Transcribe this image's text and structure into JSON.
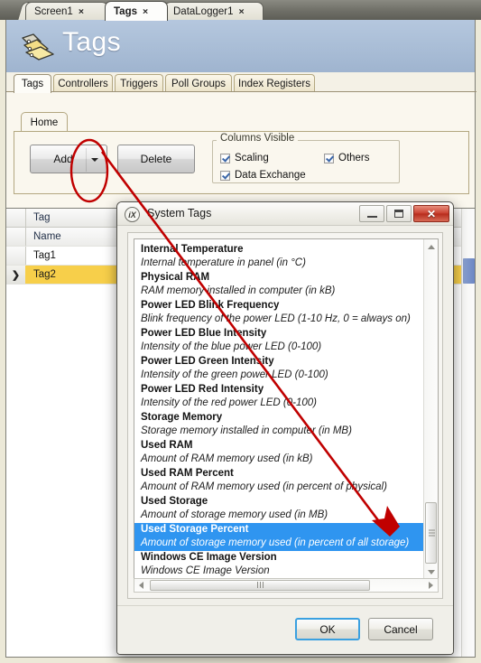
{
  "window": {
    "doc_tabs": [
      {
        "label": "Screen1",
        "close": "×",
        "active": false
      },
      {
        "label": "Tags",
        "close": "×",
        "active": true
      },
      {
        "label": "DataLogger1",
        "close": "×",
        "active": false
      }
    ]
  },
  "banner": {
    "title": "Tags",
    "icon": "tags-icon"
  },
  "inner_tabs": [
    {
      "label": "Tags",
      "active": true
    },
    {
      "label": "Controllers",
      "active": false
    },
    {
      "label": "Triggers",
      "active": false
    },
    {
      "label": "Poll Groups",
      "active": false
    },
    {
      "label": "Index Registers",
      "active": false
    }
  ],
  "ribbon": {
    "tab_label": "Home",
    "add_button": "Add",
    "delete_button": "Delete",
    "group_title": "Columns Visible",
    "checkboxes": [
      {
        "label": "Scaling",
        "checked": true
      },
      {
        "label": "Data Exchange",
        "checked": true
      },
      {
        "label": "Others",
        "checked": true
      }
    ]
  },
  "grid": {
    "group_header": "Tag",
    "column_header": "Name",
    "rows": [
      {
        "marker": "",
        "name": "Tag1",
        "selected": false
      },
      {
        "marker": "❯",
        "name": "Tag2",
        "selected": true
      }
    ]
  },
  "dialog": {
    "title": "System Tags",
    "icon": "ix-logo-icon",
    "window_buttons": {
      "minimize": "minimize-icon",
      "maximize": "maximize-icon",
      "close": "✕"
    },
    "items": [
      {
        "name": "Internal Temperature",
        "desc": "Internal temperature in panel (in °C)",
        "selected": false
      },
      {
        "name": "Physical RAM",
        "desc": "RAM memory installed in computer (in kB)",
        "selected": false
      },
      {
        "name": "Power LED Blink Frequency",
        "desc": "Blink frequency of the power LED (1-10 Hz, 0 = always on)",
        "selected": false
      },
      {
        "name": "Power LED Blue Intensity",
        "desc": "Intensity of the blue power LED (0-100)",
        "selected": false
      },
      {
        "name": "Power LED Green Intensity",
        "desc": "Intensity of the green power LED (0-100)",
        "selected": false
      },
      {
        "name": "Power LED Red Intensity",
        "desc": "Intensity of the red power LED (0-100)",
        "selected": false
      },
      {
        "name": "Storage Memory",
        "desc": "Storage memory installed in computer (in MB)",
        "selected": false
      },
      {
        "name": "Used RAM",
        "desc": "Amount of RAM memory used (in kB)",
        "selected": false
      },
      {
        "name": "Used RAM Percent",
        "desc": "Amount of RAM memory used (in percent of physical)",
        "selected": false
      },
      {
        "name": "Used Storage",
        "desc": "Amount of storage memory used (in MB)",
        "selected": false
      },
      {
        "name": "Used Storage Percent",
        "desc": "Amount of storage memory used (in percent of all storage)",
        "selected": true
      },
      {
        "name": "Windows CE Image Version",
        "desc": "Windows CE Image Version",
        "selected": false
      }
    ],
    "ok_button": "OK",
    "cancel_button": "Cancel"
  },
  "annotations": {
    "ellipse_target": "add-button-dropdown-arrow",
    "arrow_target": "used-storage-percent-list-item",
    "color": "#c00000"
  },
  "colors": {
    "selection_blue": "#2f95f0",
    "row_highlight_yellow": "#f7cf4a",
    "banner_blue": "#a9bdd6",
    "annotation_red": "#c00000"
  }
}
